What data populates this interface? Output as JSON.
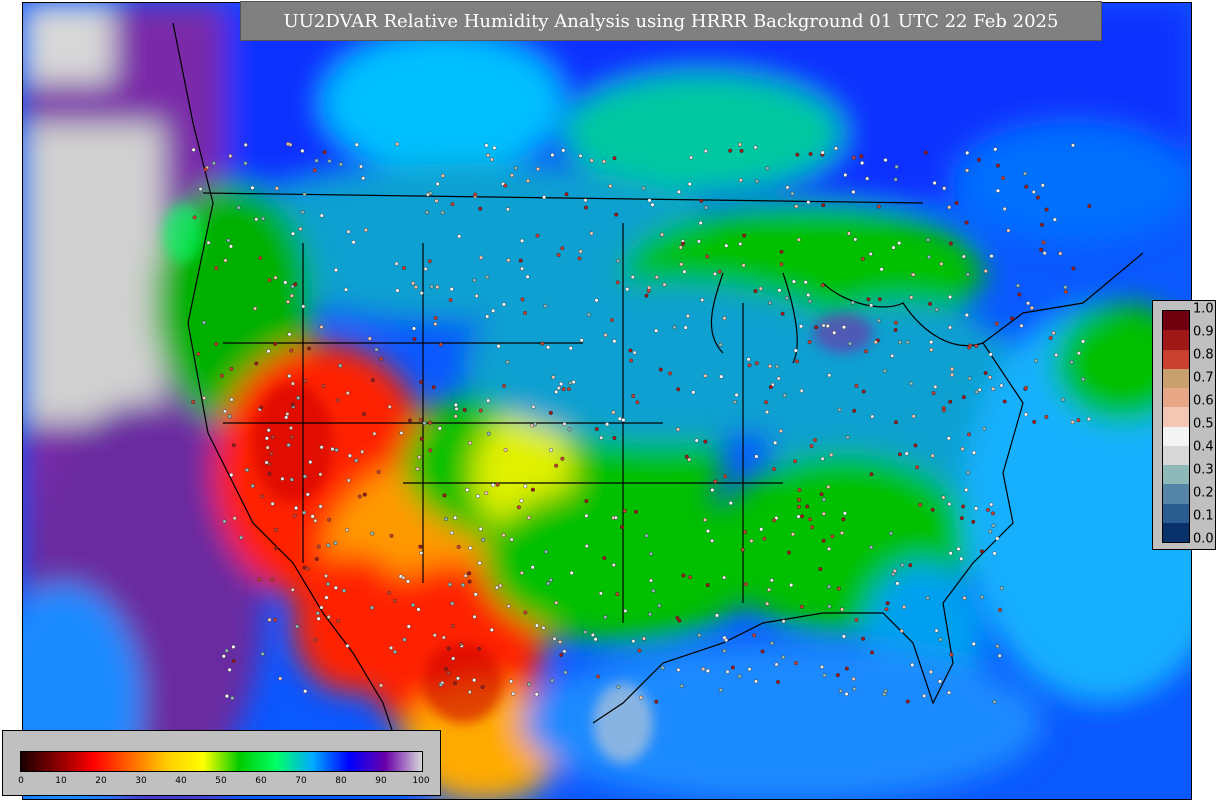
{
  "title": "UU2DVAR Relative Humidity Analysis using HRRR Background 01 UTC 22 Feb 2025",
  "colorbar_background": {
    "ticks": [
      "0",
      "10",
      "20",
      "30",
      "40",
      "50",
      "60",
      "70",
      "80",
      "90",
      "100"
    ],
    "colors": [
      "#1a0000",
      "#8b0000",
      "#ff0000",
      "#ff6600",
      "#ffcc00",
      "#ffff00",
      "#00cc00",
      "#00ff66",
      "#00aaff",
      "#0000ff",
      "#6a00aa",
      "#d8d8d8"
    ]
  },
  "colorbar_obs": {
    "ticks": [
      "0.0",
      "0.1",
      "0.2",
      "0.3",
      "0.4",
      "0.5",
      "0.6",
      "0.7",
      "0.8",
      "0.9",
      "1.0"
    ],
    "colors": [
      "#08306b",
      "#2a5d8f",
      "#5586a8",
      "#8fb8b8",
      "#d8d8d8",
      "#f4f4f4",
      "#f2c8b4",
      "#e8a888",
      "#c8a070",
      "#c84030",
      "#a01818",
      "#700010"
    ]
  },
  "map": {
    "colors": {
      "ocean_wet": "#1c5fff",
      "ocean_dry": "#12a8ff",
      "west_dry": "#ff2200",
      "southwest": "#ff9900",
      "plains": "#00c000",
      "east": "#10a0d0",
      "north": "#1030ff",
      "masked": "#d0d0d0",
      "pacific_purple": "#7a2aa8"
    }
  }
}
